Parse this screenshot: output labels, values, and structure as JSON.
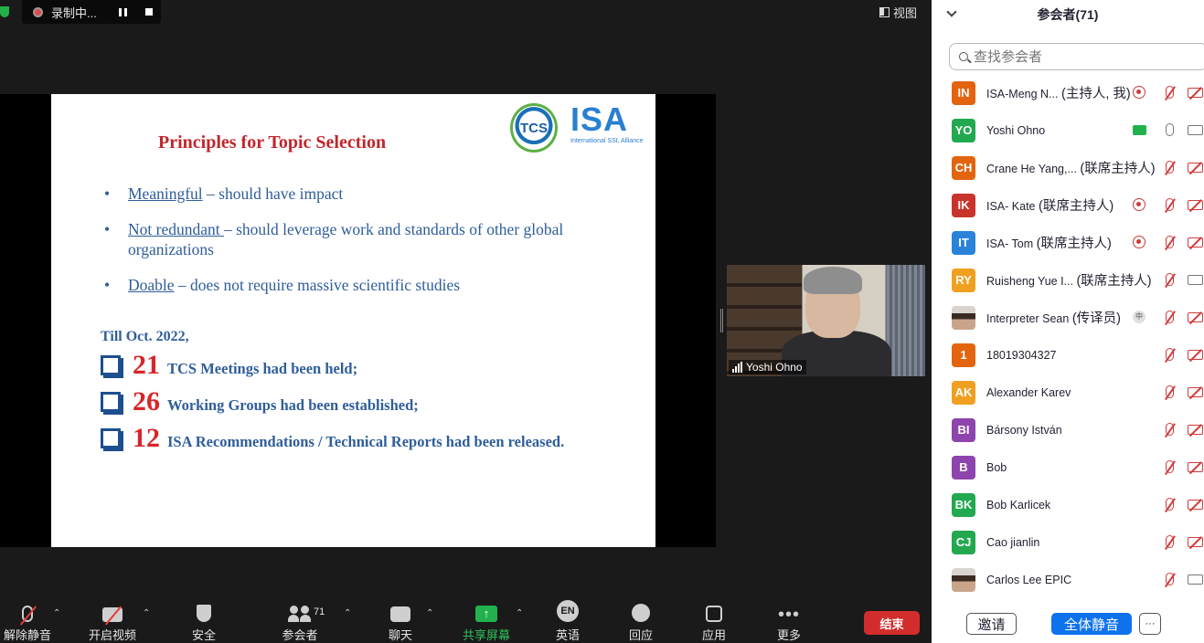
{
  "recording": {
    "label": "录制中..."
  },
  "view": {
    "label": "视图"
  },
  "slide": {
    "title": "Principles for Topic Selection",
    "logo_tcs": "TCS",
    "logo_isa": "ISA",
    "logo_isa_sub": "International SSL Alliance",
    "bullets": [
      {
        "term": "Meaningful",
        "rest": " – should have impact"
      },
      {
        "term": "Not redundant ",
        "rest": "– should leverage work and standards of other global organizations"
      },
      {
        "term": "Doable",
        "rest": " – does not require massive scientific studies"
      }
    ],
    "till": "Till Oct. 2022,",
    "stats": [
      {
        "num": "21",
        "text": "TCS Meetings had been held;"
      },
      {
        "num": "26",
        "text": "Working Groups had been established;"
      },
      {
        "num": "12",
        "text": "ISA Recommendations / Technical Reports had been released."
      }
    ]
  },
  "camera": {
    "name": "Yoshi Ohno"
  },
  "toolbar": {
    "unmute": "解除静音",
    "start_video": "开启视频",
    "security": "安全",
    "participants": "参会者",
    "participants_count": "71",
    "chat": "聊天",
    "share": "共享屏幕",
    "language": "英语",
    "language_badge": "EN",
    "reactions": "回应",
    "apps": "应用",
    "more": "更多",
    "end": "结束"
  },
  "panel": {
    "title": "参会者(71)",
    "search_placeholder": "查找参会者",
    "participants": [
      {
        "initials": "IN",
        "color": "#e3640f",
        "name": "ISA-Meng N...",
        "role": "(主持人, 我)",
        "icons": [
          "rec",
          "mic-off",
          "cam-off"
        ]
      },
      {
        "initials": "YO",
        "color": "#22a94f",
        "name": "Yoshi Ohno",
        "role": "",
        "icons": [
          "share",
          "mic-on",
          "cam-on"
        ]
      },
      {
        "initials": "CH",
        "color": "#e3640f",
        "name": "Crane He Yang,...",
        "role": "(联席主持人)",
        "icons": [
          "mic-off",
          "cam-off"
        ]
      },
      {
        "initials": "IK",
        "color": "#c8342b",
        "name": "ISA- Kate",
        "role": "(联席主持人)",
        "icons": [
          "rec",
          "mic-off",
          "cam-off"
        ]
      },
      {
        "initials": "IT",
        "color": "#2b82d9",
        "name": "ISA- Tom",
        "role": "(联席主持人)",
        "icons": [
          "rec",
          "mic-off",
          "cam-off"
        ]
      },
      {
        "initials": "RY",
        "color": "#f0a020",
        "name": "Ruisheng Yue I...",
        "role": "(联席主持人)",
        "icons": [
          "mic-off",
          "cam-on"
        ]
      },
      {
        "initials": "",
        "color": "photo",
        "name": "Interpreter Sean",
        "role": "(传译员)",
        "icons": [
          "interp",
          "mic-off",
          "cam-off"
        ]
      },
      {
        "initials": "1",
        "color": "#e3640f",
        "name": "18019304327",
        "role": "",
        "icons": [
          "mic-off",
          "cam-off"
        ]
      },
      {
        "initials": "AK",
        "color": "#f0a020",
        "name": "Alexander Karev",
        "role": "",
        "icons": [
          "mic-off",
          "cam-off"
        ]
      },
      {
        "initials": "BI",
        "color": "#8e44ad",
        "name": "Bársony István",
        "role": "",
        "icons": [
          "mic-off",
          "cam-off"
        ]
      },
      {
        "initials": "B",
        "color": "#8e44ad",
        "name": "Bob",
        "role": "",
        "icons": [
          "mic-off",
          "cam-off"
        ]
      },
      {
        "initials": "BK",
        "color": "#22a94f",
        "name": "Bob Karlicek",
        "role": "",
        "icons": [
          "mic-off",
          "cam-off"
        ]
      },
      {
        "initials": "CJ",
        "color": "#22a94f",
        "name": "Cao jianlin",
        "role": "",
        "icons": [
          "mic-off",
          "cam-off"
        ]
      },
      {
        "initials": "",
        "color": "photo",
        "name": "Carlos Lee EPIC",
        "role": "",
        "icons": [
          "mic-off",
          "cam-on"
        ]
      }
    ],
    "invite": "邀请",
    "mute_all": "全体静音",
    "more": "···"
  }
}
